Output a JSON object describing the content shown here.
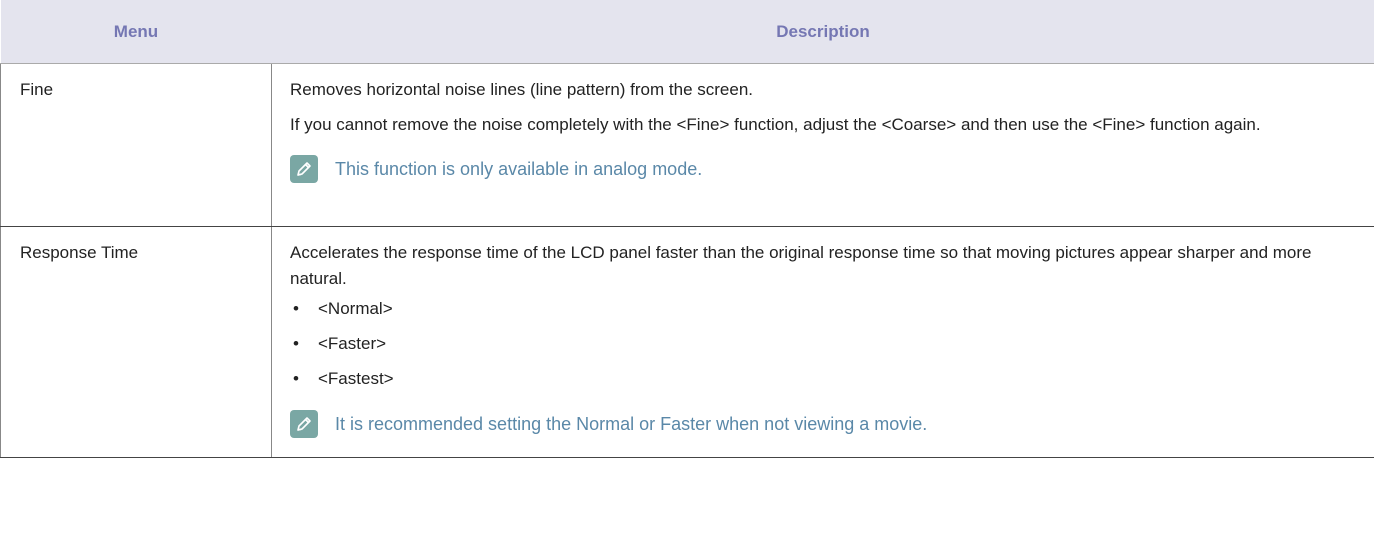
{
  "header": {
    "menu": "Menu",
    "description": "Description"
  },
  "rows": [
    {
      "menu": "Fine",
      "paragraphs": [
        "Removes horizontal noise lines (line pattern) from the screen.",
        "If you cannot remove the noise completely with the <Fine> function, adjust the <Coarse> and then use the <Fine> function again."
      ],
      "note": "This function is only available in analog mode."
    },
    {
      "menu": "Response Time",
      "paragraphs": [
        "Accelerates the response time of the LCD panel faster than the original response time so that moving pictures appear sharper and more natural."
      ],
      "bullets": [
        "<Normal>",
        "<Faster>",
        "<Fastest>"
      ],
      "note": "It is recommended setting the Normal or Faster when not viewing a movie."
    }
  ],
  "colors": {
    "header_bg": "#e4e4ee",
    "header_text": "#7577b3",
    "note_text": "#5a88a8",
    "note_icon_bg": "#7aa7a4"
  },
  "icons": {
    "note": "pencil-note-icon"
  }
}
